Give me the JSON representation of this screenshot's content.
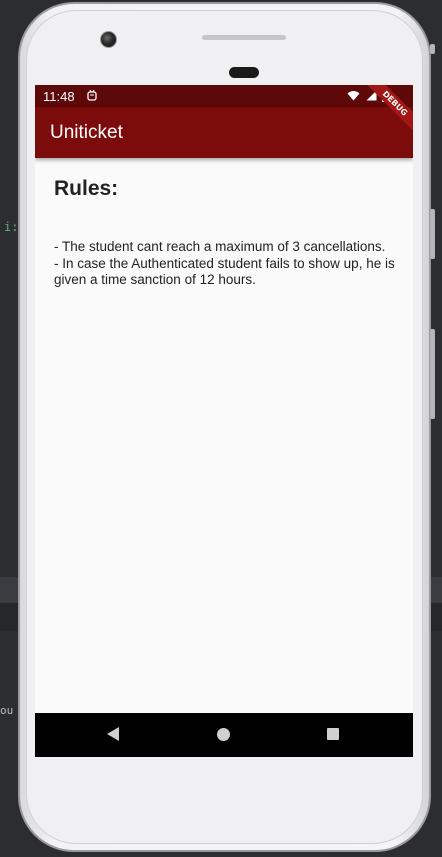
{
  "ide": {
    "code_hint": "i:",
    "code_hint2": "ou"
  },
  "status_bar": {
    "time": "11:48",
    "app_icon": "android-debug-icon",
    "icons": [
      "wifi-icon",
      "signal-icon",
      "battery-icon"
    ]
  },
  "app_bar": {
    "title": "Uniticket",
    "debug_banner": "DEBUG"
  },
  "content": {
    "heading": "Rules:",
    "rules": [
      "- The student cant reach a maximum of 3 cancellations.",
      "- In case the Authenticated student fails to show up, he is given a time sanction of 12 hours."
    ]
  },
  "nav_bar": {
    "buttons": [
      "back-icon",
      "home-icon",
      "recents-icon"
    ]
  },
  "colors": {
    "status_bar": "#5e0909",
    "app_bar": "#7c0b0b",
    "screen_bg": "#fafafa",
    "nav_bar": "#000000"
  }
}
